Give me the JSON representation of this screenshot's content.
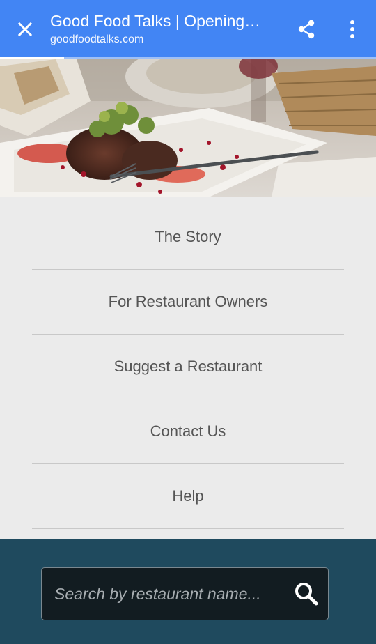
{
  "toolbar": {
    "title": "Good Food Talks | Opening…",
    "url": "goodfoodtalks.com",
    "icons": [
      "close-icon",
      "share-icon",
      "more-vert-icon"
    ]
  },
  "page_load_progress": 0.17,
  "hero": {
    "image": "food-plate-photo"
  },
  "nav": {
    "items": [
      {
        "label": "The Story"
      },
      {
        "label": "For Restaurant Owners"
      },
      {
        "label": "Suggest a Restaurant"
      },
      {
        "label": "Contact Us"
      },
      {
        "label": "Help"
      }
    ]
  },
  "search": {
    "placeholder": "Search by restaurant name...",
    "value": "",
    "icon": "search-icon"
  },
  "colors": {
    "toolbar": "#4285f4",
    "nav_bg": "#ebebeb",
    "footer": "#1f4a5e",
    "search_bg": "#121c21"
  }
}
